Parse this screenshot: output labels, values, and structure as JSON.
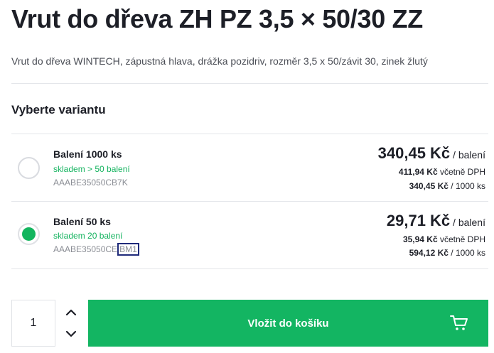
{
  "product": {
    "title": "Vrut do dřeva ZH PZ 3,5 × 50/30 ZZ",
    "description": "Vrut do dřeva WINTECH, zápustná hlava, drážka pozidriv, rozměr 3,5 x 50/závit 30, zinek žlutý"
  },
  "variants_section": {
    "title": "Vyberte variantu",
    "items": [
      {
        "name": "Balení 1000 ks",
        "stock": "skladem > 50 balení",
        "code": "AAABE35050CB7K",
        "selected": false,
        "price_main": "340,45 Kč",
        "price_main_unit": " / balení",
        "price_vat": "411,94 Kč",
        "price_vat_suffix": " včetně DPH",
        "price_per": "340,45 Kč",
        "price_per_suffix": " / 1000 ks"
      },
      {
        "name": "Balení 50 ks",
        "stock": "skladem 20 balení",
        "code_prefix": "AAABE35050CE",
        "code_highlight": "BM1",
        "selected": true,
        "price_main": "29,71 Kč",
        "price_main_unit": " / balení",
        "price_vat": "35,94 Kč",
        "price_vat_suffix": " včetně DPH",
        "price_per": "594,12 Kč",
        "price_per_suffix": " / 1000 ks"
      }
    ]
  },
  "cart": {
    "quantity": "1",
    "add_button_label": "Vložit do košíku",
    "accent_color": "#13b562"
  },
  "icons": [
    "chevron-up-icon",
    "chevron-down-icon",
    "cart-icon",
    "radio-icon"
  ]
}
